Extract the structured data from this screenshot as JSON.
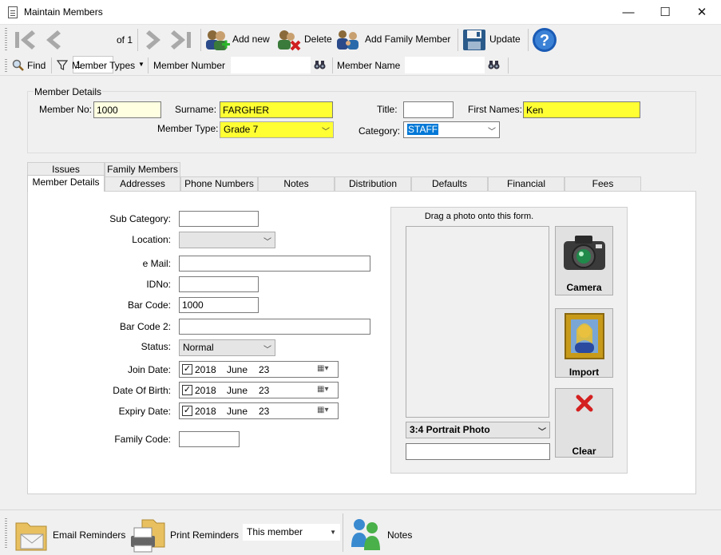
{
  "window": {
    "title": "Maintain Members",
    "minimize": "—",
    "maximize": "☐",
    "close": "✕"
  },
  "toolbar": {
    "page_value": "1",
    "page_of": "of 1",
    "add_new": "Add new",
    "delete": "Delete",
    "add_family": "Add Family Member",
    "update": "Update"
  },
  "findbar": {
    "find": "Find",
    "member_types": "Member Types",
    "member_number_label": "Member Number",
    "member_name_label": "Member Name"
  },
  "member_details": {
    "group_title": "Member Details",
    "member_no_label": "Member No:",
    "member_no": "1000",
    "surname_label": "Surname:",
    "surname": "FARGHER",
    "title_label": "Title:",
    "title": "",
    "first_names_label": "First Names:",
    "first_names": "Ken",
    "member_type_label": "Member Type:",
    "member_type": "Grade 7",
    "category_label": "Category:",
    "category": "STAFF"
  },
  "tabs_row1": [
    "Issues",
    "Family Members"
  ],
  "tabs_row2": [
    "Member Details",
    "Addresses",
    "Phone Numbers",
    "Notes",
    "Distribution",
    "Defaults",
    "Financial",
    "Fees"
  ],
  "form": {
    "sub_category_label": "Sub Category:",
    "location_label": "Location:",
    "email_label": "e Mail:",
    "idno_label": "IDNo:",
    "bar_code_label": "Bar Code:",
    "bar_code": "1000",
    "bar_code2_label": "Bar Code 2:",
    "status_label": "Status:",
    "status": "Normal",
    "join_date_label": "Join Date:",
    "dob_label": "Date Of Birth:",
    "expiry_label": "Expiry Date:",
    "family_code_label": "Family Code:",
    "date_year": "2018",
    "date_month": "June",
    "date_day": "23"
  },
  "photo": {
    "hint": "Drag a photo onto this form.",
    "format": "3:4 Portrait Photo",
    "camera": "Camera",
    "import": "Import",
    "clear": "Clear"
  },
  "bottom": {
    "email_reminders": "Email Reminders",
    "print_reminders": "Print Reminders",
    "scope": "This member",
    "notes": "Notes"
  }
}
